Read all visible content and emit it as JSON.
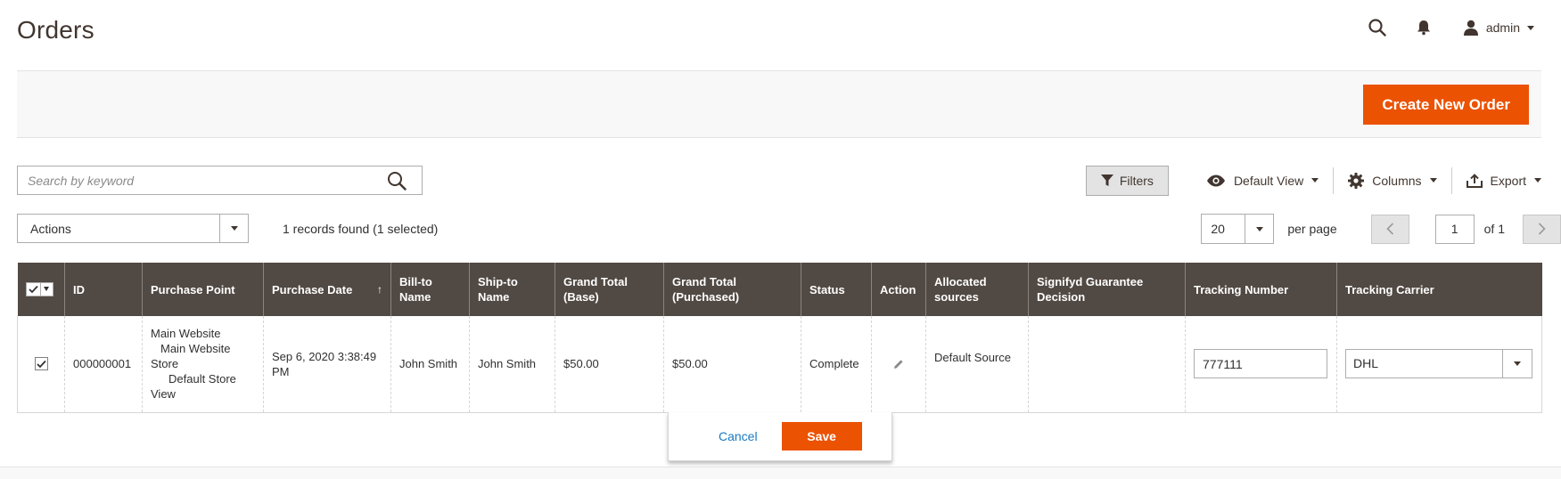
{
  "page": {
    "title": "Orders"
  },
  "header": {
    "user_name": "admin"
  },
  "actions_bar": {
    "create_label": "Create New Order"
  },
  "search": {
    "placeholder": "Search by keyword"
  },
  "toolbar": {
    "filters_label": "Filters",
    "view_label": "Default View",
    "columns_label": "Columns",
    "export_label": "Export"
  },
  "mass_actions": {
    "label": "Actions"
  },
  "records": {
    "text": "1 records found (1 selected)"
  },
  "pager": {
    "per_page_value": "20",
    "per_page_label": "per page",
    "current_page": "1",
    "of_label": "of 1"
  },
  "grid": {
    "columns": [
      "ID",
      "Purchase Point",
      "Purchase Date",
      "Bill-to Name",
      "Ship-to Name",
      "Grand Total (Base)",
      "Grand Total (Purchased)",
      "Status",
      "Action",
      "Allocated sources",
      "Signifyd Guarantee Decision",
      "Tracking Number",
      "Tracking Carrier"
    ],
    "column_display": {
      "bill_to": [
        "Bill-to",
        "Name"
      ],
      "ship_to": [
        "Ship-to",
        "Name"
      ],
      "gt_base": [
        "Grand Total",
        "(Base)"
      ],
      "gt_purchased": [
        "Grand Total",
        "(Purchased)"
      ],
      "allocated": [
        "Allocated",
        "sources"
      ],
      "signifyd": [
        "Signifyd Guarantee",
        "Decision"
      ]
    },
    "sort_arrow": "↑",
    "rows": [
      {
        "id": "000000001",
        "purchase_point": [
          "Main Website",
          "Main Website",
          "Store",
          "Default Store",
          "View"
        ],
        "purchase_date": [
          "Sep 6, 2020 3:38:49",
          "PM"
        ],
        "bill_to": "John Smith",
        "ship_to": "John Smith",
        "gt_base": "$50.00",
        "gt_purchased": "$50.00",
        "status": "Complete",
        "allocated": "Default Source",
        "signifyd": "",
        "tracking_number": "777111",
        "tracking_carrier": "DHL"
      }
    ]
  },
  "inline_edit": {
    "cancel_label": "Cancel",
    "save_label": "Save"
  },
  "colors": {
    "accent": "#eb5202",
    "grid_header": "#514943",
    "link": "#1979c3"
  },
  "icons": [
    "search-icon",
    "bell-icon",
    "user-icon",
    "filter-icon",
    "eye-icon",
    "gear-icon",
    "export-icon",
    "pencil-icon",
    "checkmark-icon",
    "chevron-left-icon",
    "chevron-right-icon"
  ]
}
